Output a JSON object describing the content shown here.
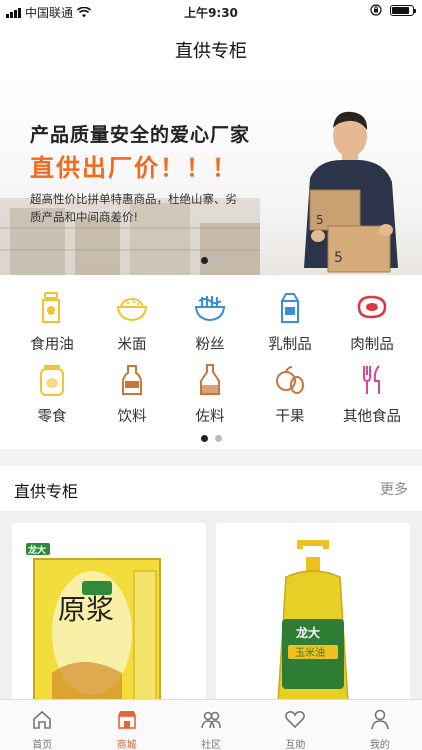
{
  "status_bar": {
    "carrier": "中国联通",
    "time": "上午9:30",
    "battery_level": 0.85
  },
  "header": {
    "title": "直供专柜"
  },
  "banner": {
    "headline": "产品质量安全的爱心厂家",
    "subheadline": "直供出厂价！！！",
    "description": "超高性价比拼单特惠商品，杜绝山寨、劣质产品和中间商差价!",
    "box_number": "5",
    "page_count": 2,
    "active_page": 1
  },
  "categories": [
    {
      "label": "食用油",
      "icon": "oil-bottle-icon",
      "color": "#f1c232"
    },
    {
      "label": "米面",
      "icon": "rice-bowl-icon",
      "color": "#f1c232"
    },
    {
      "label": "粉丝",
      "icon": "noodle-bowl-icon",
      "color": "#3a8fd8"
    },
    {
      "label": "乳制品",
      "icon": "milk-carton-icon",
      "color": "#3a8fd8"
    },
    {
      "label": "肉制品",
      "icon": "meat-icon",
      "color": "#e0353f"
    },
    {
      "label": "零食",
      "icon": "snack-jar-icon",
      "color": "#f1c232"
    },
    {
      "label": "饮料",
      "icon": "drink-bottle-icon",
      "color": "#c9763a"
    },
    {
      "label": "佐料",
      "icon": "seasoning-bottle-icon",
      "color": "#c9763a"
    },
    {
      "label": "干果",
      "icon": "dried-fruit-icon",
      "color": "#c9763a"
    },
    {
      "label": "其他食品",
      "icon": "cutlery-icon",
      "color": "#d6479a"
    }
  ],
  "category_pager": {
    "page_count": 2,
    "active_page": 1
  },
  "section": {
    "title": "直供专柜",
    "more_label": "更多"
  },
  "products": [
    {
      "brand": "龙大",
      "name": "原浆",
      "package": "oil-tin-icon"
    },
    {
      "brand": "龙大",
      "name": "玉米油",
      "package": "oil-jug-icon"
    }
  ],
  "tabbar": [
    {
      "label": "首页",
      "icon": "home-icon",
      "active": false
    },
    {
      "label": "商城",
      "icon": "shop-icon",
      "active": true
    },
    {
      "label": "社区",
      "icon": "community-icon",
      "active": false
    },
    {
      "label": "互助",
      "icon": "heart-icon",
      "active": false
    },
    {
      "label": "我的",
      "icon": "user-icon",
      "active": false
    }
  ],
  "colors": {
    "accent": "#f26b1d",
    "tab_active": "#e8623a"
  }
}
